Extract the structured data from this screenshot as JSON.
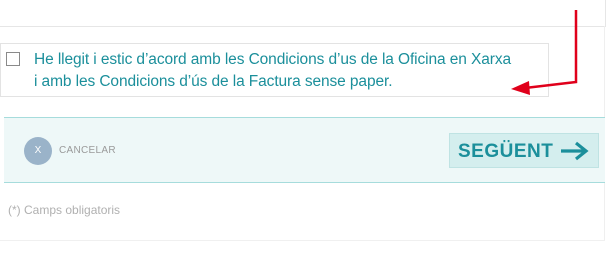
{
  "agreement": {
    "line1_prefix": "He llegit i estic d’acord amb les ",
    "line1_link": "Condicions d’us de la Oficina en Xarxa",
    "line2_prefix": "i amb les ",
    "line2_link": "Condicions d’ús de la Factura sense paper",
    "line2_suffix": ".",
    "checked": false
  },
  "actions": {
    "cancel_icon_glyph": "X",
    "cancel_label": "CANCELAR",
    "next_label": "SEGÜENT",
    "next_icon": "arrow-right-icon"
  },
  "footnote": "(*) Camps obligatoris",
  "colors": {
    "brand_teal": "#1b8f9b",
    "bar_background": "#eef8f8",
    "button_background": "#d4eeee",
    "cancel_circle": "#9ab3c9",
    "annotation_red": "#e0001b"
  }
}
